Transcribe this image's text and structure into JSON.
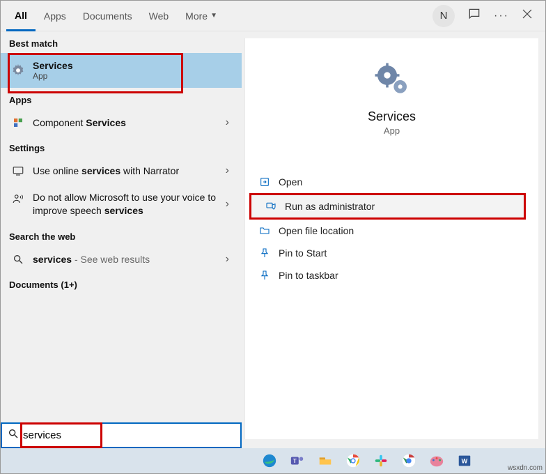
{
  "tabs": {
    "all": "All",
    "apps": "Apps",
    "documents": "Documents",
    "web": "Web",
    "more": "More"
  },
  "user_initial": "N",
  "left": {
    "best_match_label": "Best match",
    "best_match": {
      "title": "Services",
      "sub": "App"
    },
    "apps_label": "Apps",
    "apps_item_prefix": "Component ",
    "apps_item_bold": "Services",
    "settings_label": "Settings",
    "setting1_a": "Use online ",
    "setting1_b": "services",
    "setting1_c": " with Narrator",
    "setting2_a": "Do not allow Microsoft to use your voice to improve speech ",
    "setting2_b": "services",
    "searchweb_label": "Search the web",
    "web_item_bold": "services",
    "web_item_suffix": " - See web results",
    "documents_label": "Documents (1+)"
  },
  "detail": {
    "title": "Services",
    "sub": "App",
    "actions": {
      "open": "Open",
      "run_admin": "Run as administrator",
      "open_loc": "Open file location",
      "pin_start": "Pin to Start",
      "pin_taskbar": "Pin to taskbar"
    }
  },
  "search": {
    "value": "services"
  },
  "watermark": "wsxdn.com"
}
